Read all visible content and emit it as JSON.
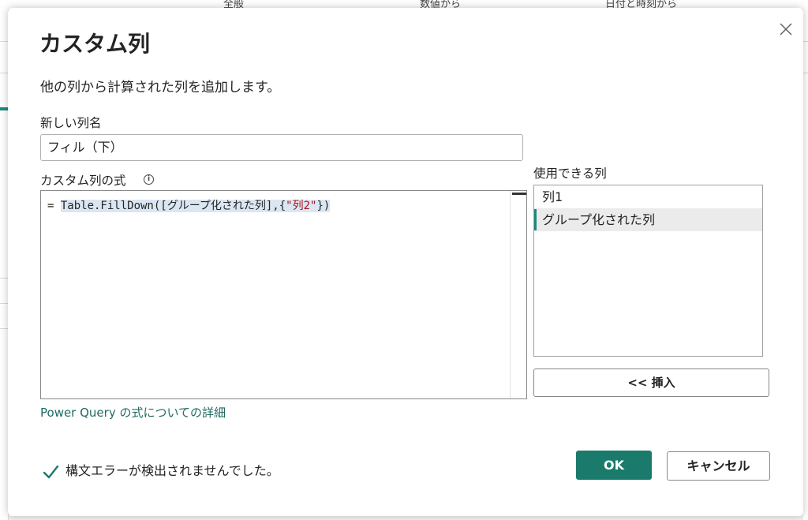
{
  "background": {
    "ribbon_tabs": [
      "全般",
      "数値から",
      "日付と時刻から"
    ]
  },
  "dialog": {
    "title": "カスタム列",
    "description": "他の列から計算された列を追加します。",
    "new_column_name_label": "新しい列名",
    "new_column_name_value": "フィル（下）",
    "formula_label": "カスタム列の式",
    "formula": {
      "prefix": "= ",
      "selected_pre": "Table.FillDown([グループ化された列],{",
      "string": "\"列2\"",
      "selected_post": "})"
    },
    "available_columns_label": "使用できる列",
    "available_columns": [
      {
        "label": "列1",
        "selected": false
      },
      {
        "label": "グループ化された列",
        "selected": true
      }
    ],
    "insert_button": "<< 挿入",
    "learn_link": "Power Query の式についての詳細",
    "status_text": "構文エラーが検出されませんでした。",
    "ok_button": "OK",
    "cancel_button": "キャンセル"
  },
  "colors": {
    "accent": "#1a7a6b",
    "link": "#1f6b61",
    "selection_highlight": "#dbe6f3",
    "string_literal": "#a31515"
  },
  "icons": {
    "close": "close-icon",
    "info": "info-icon",
    "status": "checkmark-icon"
  }
}
